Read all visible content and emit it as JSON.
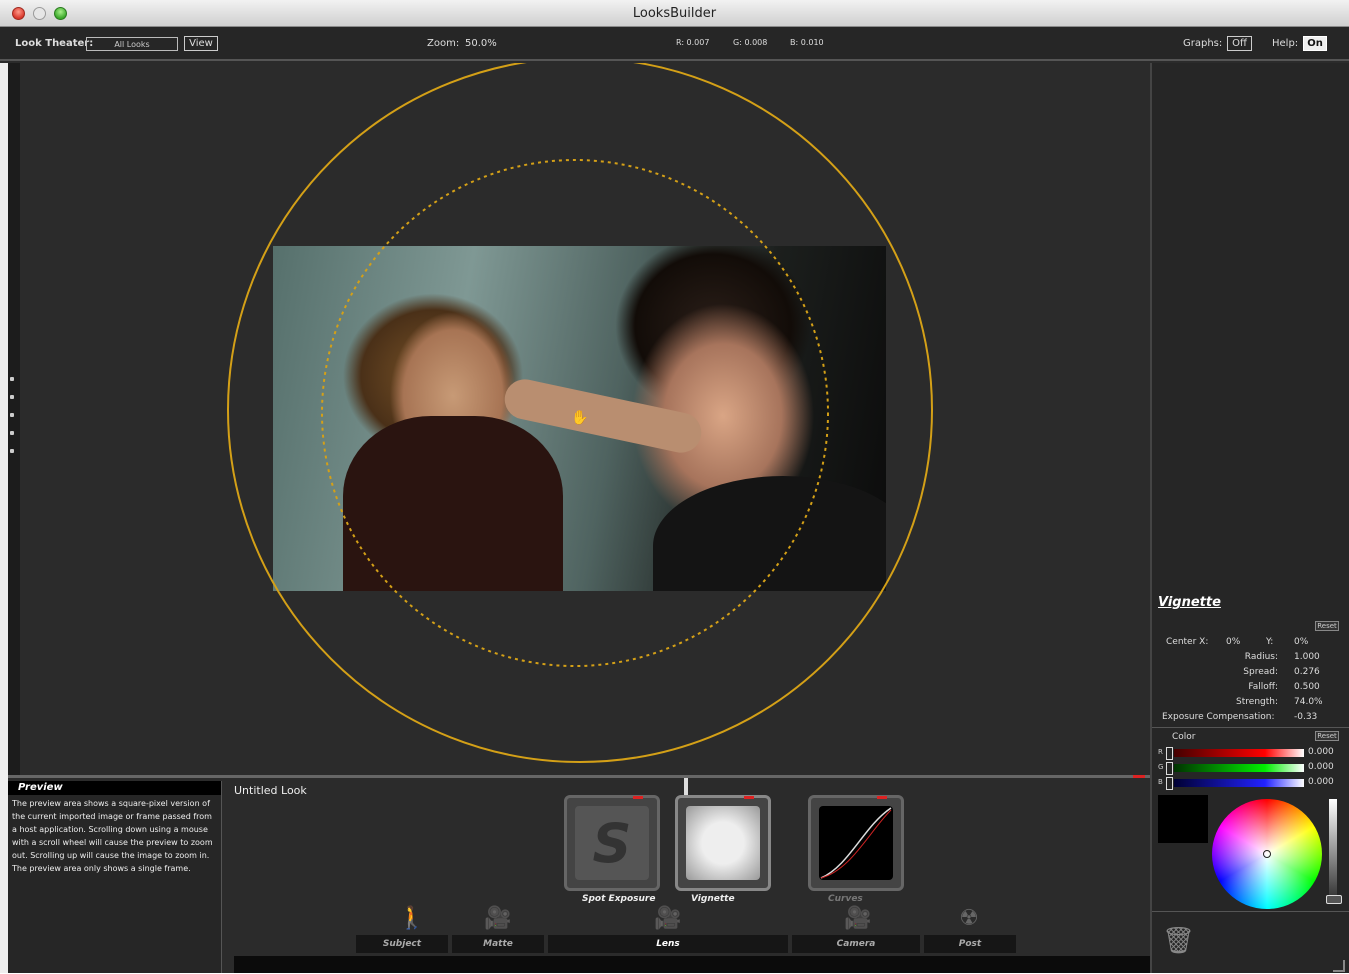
{
  "window": {
    "title": "LooksBuilder"
  },
  "topbar": {
    "look_theater_label": "Look Theater:",
    "look_theater_value": "All Looks",
    "view_button": "View",
    "zoom_label": "Zoom:",
    "zoom_value": "50.0%",
    "r_readout": "R: 0.007",
    "g_readout": "G: 0.008",
    "b_readout": "B: 0.010",
    "graphs_label": "Graphs:",
    "graphs_value": "Off",
    "help_label": "Help:",
    "help_value": "On"
  },
  "vignette": {
    "title": "Vignette",
    "reset_label": "Reset",
    "center_x_label": "Center X:",
    "center_x_value": "0%",
    "y_label": "Y:",
    "y_value": "0%",
    "radius_label": "Radius:",
    "radius_value": "1.000",
    "spread_label": "Spread:",
    "spread_value": "0.276",
    "falloff_label": "Falloff:",
    "falloff_value": "0.500",
    "strength_label": "Strength:",
    "strength_value": "74.0%",
    "exposure_label": "Exposure Compensation:",
    "exposure_value": "-0.33",
    "color_label": "Color",
    "color_reset_label": "Reset",
    "r_letter": "R",
    "g_letter": "G",
    "b_letter": "B",
    "r_value": "0.000",
    "g_value": "0.000",
    "b_value": "0.000"
  },
  "help_panel": {
    "title": "Preview",
    "text": "The preview area shows a square-pixel version of the current imported image or frame passed from a host application. Scrolling down using a mouse with a scroll wheel will cause the preview to zoom out. Scrolling up will cause the image to zoom in. The preview area only shows a single frame."
  },
  "look": {
    "title": "Untitled Look",
    "tools": [
      {
        "label": "Spot Exposure"
      },
      {
        "label": "Vignette"
      },
      {
        "label": "Curves"
      }
    ],
    "tabs": [
      {
        "label": "Subject"
      },
      {
        "label": "Matte"
      },
      {
        "label": "Lens"
      },
      {
        "label": "Camera"
      },
      {
        "label": "Post"
      }
    ],
    "active_tab": "Lens"
  },
  "colors": {
    "vignette_ring": "#d4a017",
    "background": "#2b2b2b"
  }
}
